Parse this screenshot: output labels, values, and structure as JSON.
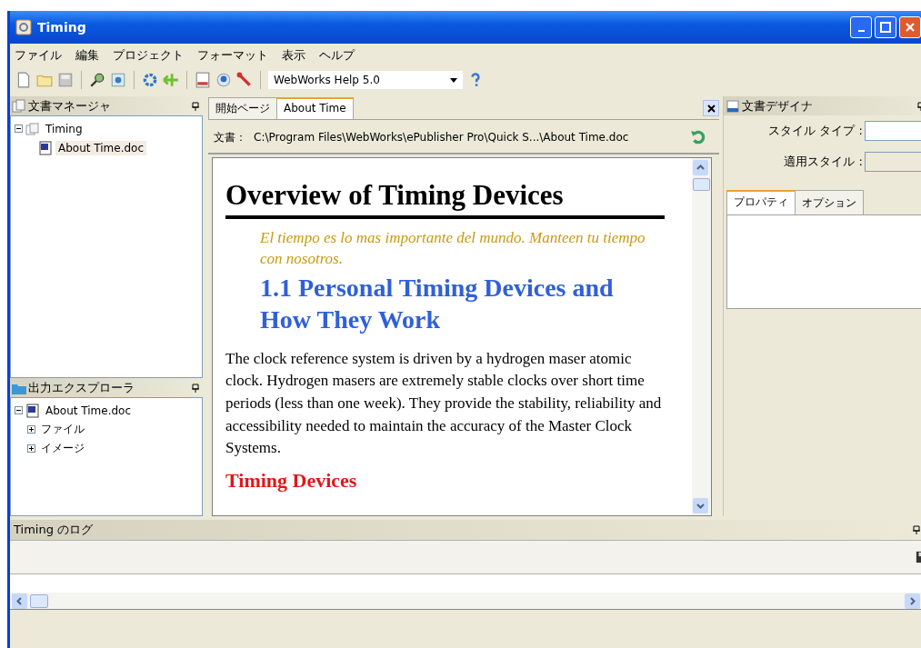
{
  "window": {
    "title": "Timing"
  },
  "menu": [
    "ファイル",
    "編集",
    "プロジェクト",
    "フォーマット",
    "表示",
    "ヘルプ"
  ],
  "toolbar": {
    "format": "WebWorks Help 5.0"
  },
  "document_manager": {
    "title": "文書マネージャ",
    "tree": [
      {
        "label": "Timing",
        "expanded": true,
        "selected": false,
        "children": [
          {
            "label": "About Time.doc",
            "selected": true
          }
        ]
      }
    ]
  },
  "output_explorer": {
    "title": "出力エクスプローラ",
    "tree": [
      {
        "label": "About Time.doc",
        "expanded": true,
        "children": [
          {
            "label": "ファイル",
            "expanded": false
          },
          {
            "label": "イメージ",
            "expanded": false
          }
        ]
      }
    ]
  },
  "editor": {
    "tabs": [
      {
        "label": "開始ページ",
        "selected": false
      },
      {
        "label": "About Time",
        "selected": true
      }
    ],
    "path_label": "文書：",
    "path": "C:\\Program  Files\\WebWorks\\ePublisher  Pro\\Quick  S...\\About Time.doc",
    "heading": "Overview of Timing Devices",
    "quote": "El tiempo es lo mas importante del mundo. Manteen tu tiempo con nosotros.",
    "subheading": "1.1 Personal Timing Devices and How They Work",
    "paragraph": "The clock reference system is driven by a hydrogen maser atomic clock. Hydrogen masers are extremely stable clocks over short time periods (less than one week). They provide the stability, reliability and accessibility needed to maintain the accuracy of the Master Clock Systems.",
    "section": "Timing Devices"
  },
  "designer": {
    "title": "文書デザイナ",
    "fields": [
      {
        "label": "スタイル タイプ :",
        "disabled": false
      },
      {
        "label": "適用スタイル :",
        "disabled": true
      }
    ],
    "tabs": [
      {
        "label": "プロパティ",
        "selected": true
      },
      {
        "label": "オプション",
        "selected": false
      }
    ]
  },
  "log": {
    "title": "Timing のログ"
  }
}
